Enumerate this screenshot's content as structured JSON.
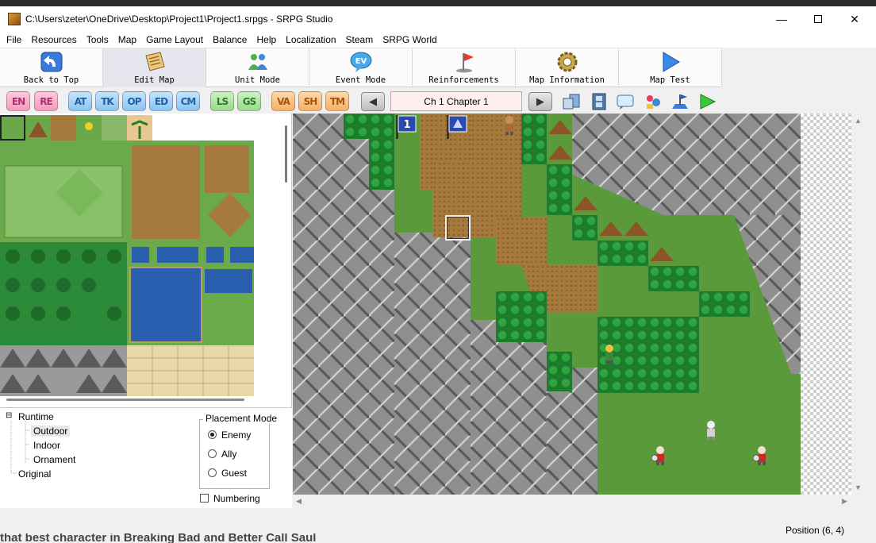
{
  "window": {
    "title": "C:\\Users\\zeter\\OneDrive\\Desktop\\Project1\\Project1.srpgs - SRPG Studio",
    "controls": [
      "minimize",
      "maximize",
      "close"
    ]
  },
  "menu": [
    "File",
    "Resources",
    "Tools",
    "Map",
    "Game Layout",
    "Balance",
    "Help",
    "Localization",
    "Steam",
    "SRPG World"
  ],
  "toolbar": [
    {
      "label": "Back to Top",
      "icon": "back-arrow-icon"
    },
    {
      "label": "Edit Map",
      "icon": "scroll-map-icon",
      "active": true
    },
    {
      "label": "Unit Mode",
      "icon": "unit-people-icon"
    },
    {
      "label": "Event Mode",
      "icon": "event-bubble-icon"
    },
    {
      "label": "Reinforcements",
      "icon": "flag-icon"
    },
    {
      "label": "Map Information",
      "icon": "gear-icon"
    },
    {
      "label": "Map Test",
      "icon": "play-triangle-icon"
    }
  ],
  "small_toolbar": {
    "layer_buttons": [
      {
        "label": "EN",
        "color": "pink"
      },
      {
        "label": "RE",
        "color": "pink"
      },
      {
        "label": "AT",
        "color": "blue"
      },
      {
        "label": "TK",
        "color": "blue"
      },
      {
        "label": "OP",
        "color": "blue"
      },
      {
        "label": "ED",
        "color": "blue"
      },
      {
        "label": "CM",
        "color": "blue"
      },
      {
        "label": "LS",
        "color": "green"
      },
      {
        "label": "GS",
        "color": "green"
      },
      {
        "label": "VA",
        "color": "orange"
      },
      {
        "label": "SH",
        "color": "orange"
      },
      {
        "label": "TM",
        "color": "orange"
      }
    ],
    "chapter": "Ch 1 Chapter 1"
  },
  "tree": {
    "root": "Runtime",
    "children": [
      "Outdoor",
      "Indoor",
      "Ornament"
    ],
    "selected": "Outdoor",
    "other": "Original"
  },
  "placement": {
    "title": "Placement Mode",
    "options": [
      "Enemy",
      "Ally",
      "Guest"
    ],
    "selected": "Enemy",
    "numbering_label": "Numbering",
    "numbering_checked": false
  },
  "map_labels": {
    "flag_number": "1"
  },
  "status": {
    "position": "Position (6, 4)"
  },
  "background_text": "that best character in Breaking Bad and Better Call Saul",
  "colors": {
    "grass": "#5a9a3a",
    "mountain": "#8f8f8f",
    "dirt": "#a57a3c",
    "forest": "#1e7d2e",
    "water": "#2a5fb0"
  }
}
